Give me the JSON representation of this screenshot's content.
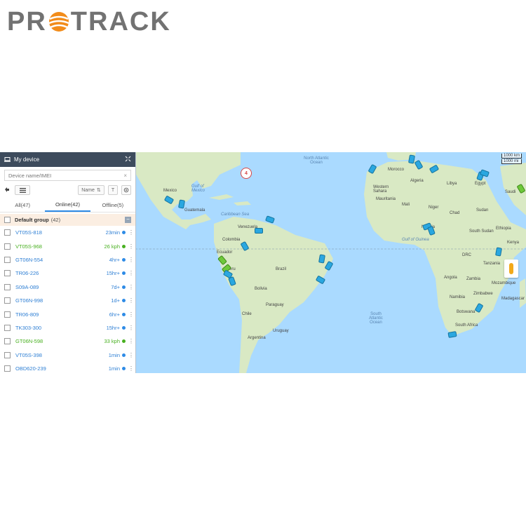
{
  "logo": {
    "text_before": "PR",
    "text_after": "TRACK"
  },
  "sidebar": {
    "title": "My device",
    "search_placeholder": "Device name/IMEI",
    "sort_label": "Name",
    "text_button": "T",
    "tabs": [
      {
        "label": "All(47)"
      },
      {
        "label": "Online(42)"
      },
      {
        "label": "Offline(5)"
      }
    ],
    "group": {
      "name": "Default group",
      "count": "(42)"
    },
    "devices": [
      {
        "name": "VT05S-818",
        "status": "23min"
      },
      {
        "name": "VT05S-968",
        "status": "26 kph"
      },
      {
        "name": "GT06N-554",
        "status": "4hr+"
      },
      {
        "name": "TR06-226",
        "status": "15hr+"
      },
      {
        "name": "S09A-089",
        "status": "7d+"
      },
      {
        "name": "GT06N-998",
        "status": "1d+"
      },
      {
        "name": "TR06-809",
        "status": "6hr+"
      },
      {
        "name": "TK303-300",
        "status": "15hr+"
      },
      {
        "name": "GT06N-598",
        "status": "33 kph"
      },
      {
        "name": "VT05S-398",
        "status": "1min"
      },
      {
        "name": "OBD620-239",
        "status": "1min"
      }
    ]
  },
  "map": {
    "cluster_count": "4",
    "scale": [
      "1000 km",
      "1000 mi"
    ],
    "labels": {
      "north_atlantic": "North Atlantic Ocean",
      "south_atlantic": "South Atlantic Ocean",
      "gulf_mexico": "Gulf of Mexico",
      "caribbean": "Caribbean Sea",
      "gulf_guinea": "Gulf of Guinea",
      "mexico": "Mexico",
      "guatemala": "Guatemala",
      "venezuela": "Venezuela",
      "colombia": "Colombia",
      "ecuador": "Ecuador",
      "peru": "Peru",
      "brazil": "Brazil",
      "bolivia": "Bolivia",
      "paraguay": "Paraguay",
      "chile": "Chile",
      "argentina": "Argentina",
      "uruguay": "Uruguay",
      "morocco": "Morocco",
      "algeria": "Algeria",
      "libya": "Libya",
      "egypt": "Egypt",
      "western_sahara": "Western Sahara",
      "mauritania": "Mauritania",
      "mali": "Mali",
      "niger": "Niger",
      "chad": "Chad",
      "sudan": "Sudan",
      "south_sudan": "South Sudan",
      "ethiopia": "Ethiopia",
      "nigeria": "Nigeria",
      "drc": "DRC",
      "tanzania": "Tanzania",
      "angola": "Angola",
      "zambia": "Zambia",
      "namibia": "Namibia",
      "botswana": "Botswana",
      "zimbabwe": "Zimbabwe",
      "mozambique": "Mozambique",
      "madagascar": "Madagascar",
      "south_africa": "South Africa",
      "kenya": "Kenya",
      "saudi": "Saudi"
    }
  },
  "colors": {
    "accent": "#2e8be6",
    "moving": "#48b020",
    "header": "#3d4b5c",
    "water": "#aadaff",
    "land": "#d9e9c4"
  }
}
